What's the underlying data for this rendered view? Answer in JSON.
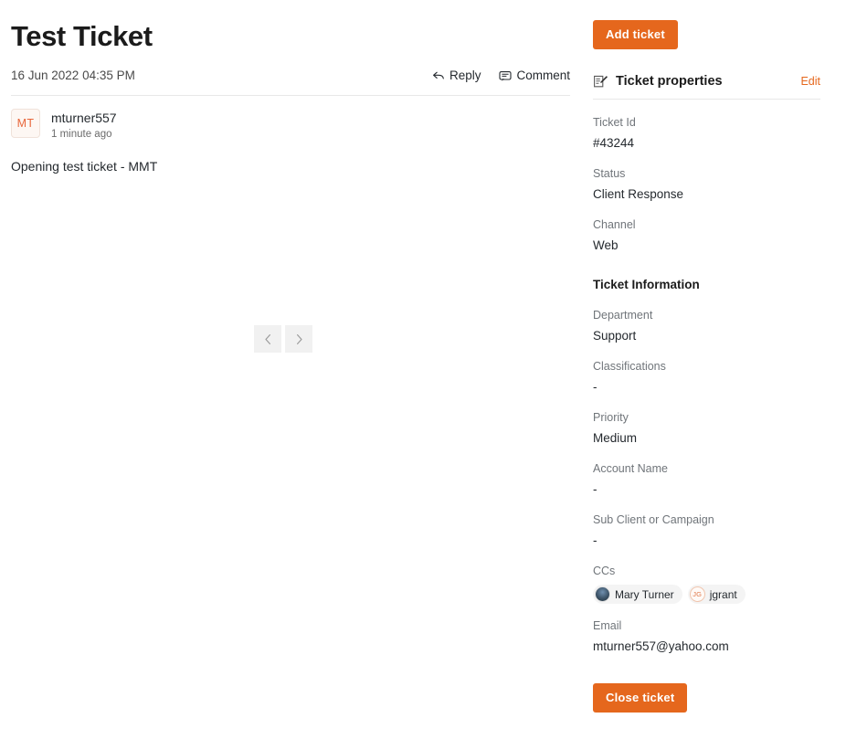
{
  "main": {
    "title": "Test Ticket",
    "date": "16 Jun 2022 04:35 PM",
    "actions": {
      "reply": "Reply",
      "comment": "Comment"
    },
    "message": {
      "avatar_initials": "MT",
      "author": "mturner557",
      "time": "1 minute ago",
      "body": "Opening test ticket - MMT"
    },
    "pager": {
      "prev_icon": "chevron-left-icon",
      "next_icon": "chevron-right-icon"
    }
  },
  "sidebar": {
    "add_ticket_label": "Add ticket",
    "properties_icon": "edit-document-icon",
    "properties_title": "Ticket properties",
    "edit_label": "Edit",
    "properties": [
      {
        "label": "Ticket Id",
        "value": "#43244"
      },
      {
        "label": "Status",
        "value": "Client Response"
      },
      {
        "label": "Channel",
        "value": "Web"
      }
    ],
    "information_heading": "Ticket Information",
    "information": [
      {
        "label": "Department",
        "value": "Support"
      },
      {
        "label": "Classifications",
        "value": "-"
      },
      {
        "label": "Priority",
        "value": "Medium"
      },
      {
        "label": "Account Name",
        "value": "-"
      },
      {
        "label": "Sub Client or Campaign",
        "value": "-"
      }
    ],
    "ccs": {
      "label": "CCs",
      "items": [
        {
          "name": "Mary Turner",
          "avatar_type": "photo",
          "initials": ""
        },
        {
          "name": "jgrant",
          "avatar_type": "initials",
          "initials": "JG"
        }
      ]
    },
    "email": {
      "label": "Email",
      "value": "mturner557@yahoo.com"
    },
    "close_ticket_label": "Close ticket"
  },
  "colors": {
    "accent": "#e5671d",
    "text": "#24292e",
    "muted": "#70757a",
    "divider": "#e8e8e8",
    "pager_bg": "#f1f1f1"
  }
}
